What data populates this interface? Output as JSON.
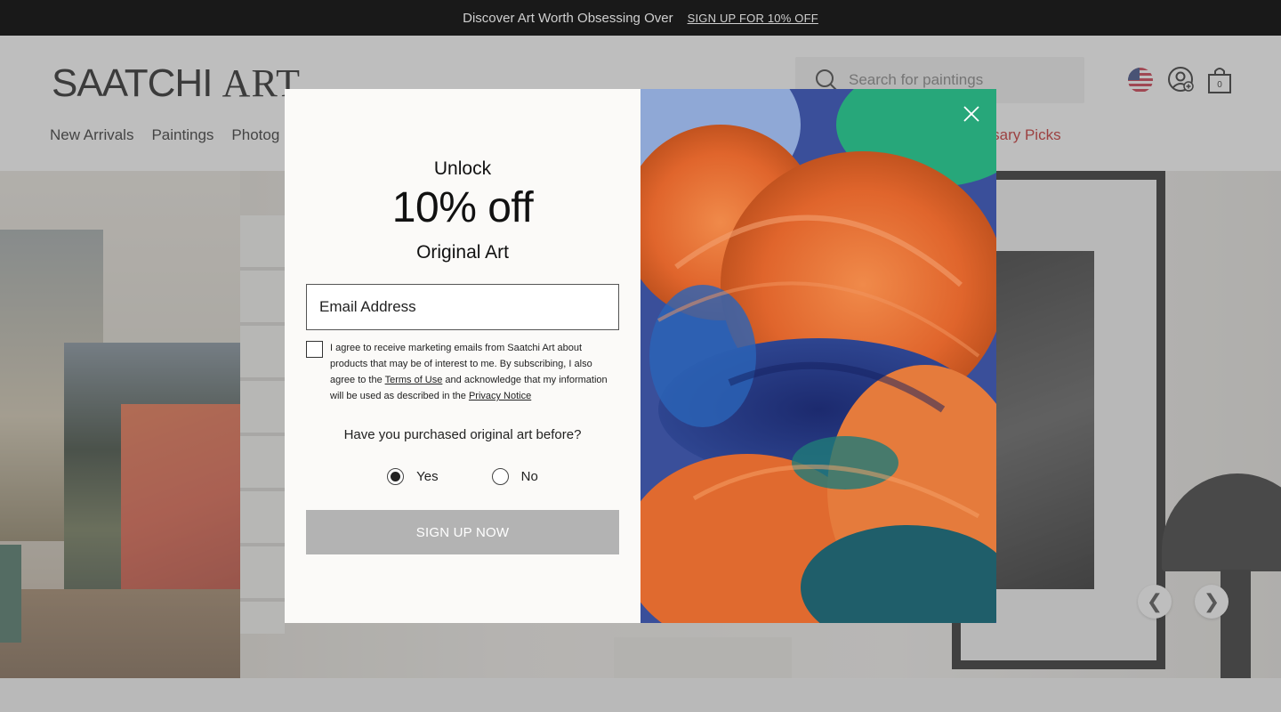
{
  "promo": {
    "text": "Discover Art Worth Obsessing Over",
    "link": "SIGN UP FOR 10% OFF"
  },
  "header": {
    "logo_main": "SAATCHI",
    "logo_art": "ART",
    "search_placeholder": "Search for paintings",
    "cart_count": "0",
    "nav": [
      "New Arrivals",
      "Paintings",
      "Photog"
    ],
    "nav_highlight": "ersary Picks",
    "icons": [
      "us-flag-icon",
      "account-icon",
      "cart-icon",
      "search-icon"
    ]
  },
  "hero": {
    "prev": "❮",
    "next": "❯"
  },
  "modal": {
    "unlock": "Unlock",
    "discount": "10% off",
    "subtitle": "Original Art",
    "email_placeholder": "Email Address",
    "consent_part1": "I agree to receive marketing emails from Saatchi Art about products that may be of interest to me. By subscribing, I also agree to the ",
    "terms_link": "Terms of Use",
    "consent_part2": " and acknowledge that my information will be used as described in the ",
    "privacy_link": "Privacy Notice",
    "question": "Have you purchased original art before?",
    "option_yes": "Yes",
    "option_no": "No",
    "selected": "Yes",
    "cta": "SIGN UP NOW"
  },
  "colors": {
    "promo_bg": "#191919",
    "nav_highlight": "#c21c1c",
    "cta_bg": "#b3b3b3",
    "modal_bg": "#fbfaf8"
  }
}
